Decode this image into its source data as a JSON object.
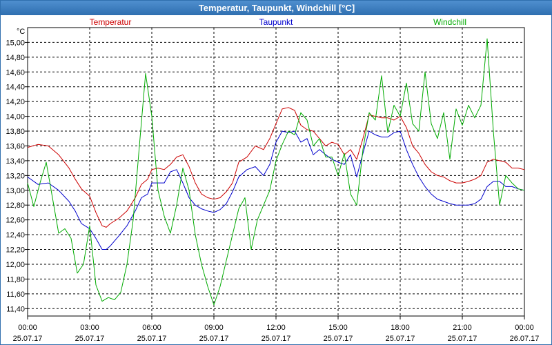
{
  "window": {
    "title": "Temperatur, Taupunkt, Windchill [°C]"
  },
  "chart_data": {
    "type": "line",
    "title": "Temperatur, Taupunkt, Windchill [°C]",
    "ylabel": "°C",
    "ylim": [
      11.3,
      15.2
    ],
    "xlim": [
      0,
      24
    ],
    "grid": true,
    "legend_position": "top",
    "x_ticks": [
      {
        "x": 0,
        "time": "00:00",
        "date": "25.07.17"
      },
      {
        "x": 3,
        "time": "03:00",
        "date": "25.07.17"
      },
      {
        "x": 6,
        "time": "06:00",
        "date": "25.07.17"
      },
      {
        "x": 9,
        "time": "09:00",
        "date": "25.07.17"
      },
      {
        "x": 12,
        "time": "12:00",
        "date": "25.07.17"
      },
      {
        "x": 15,
        "time": "15:00",
        "date": "25.07.17"
      },
      {
        "x": 18,
        "time": "18:00",
        "date": "25.07.17"
      },
      {
        "x": 21,
        "time": "21:00",
        "date": "25.07.17"
      },
      {
        "x": 24,
        "time": "00:00",
        "date": "26.07.17"
      }
    ],
    "y_ticks": [
      "11,40",
      "11,60",
      "11,80",
      "12,00",
      "12,20",
      "12,40",
      "12,60",
      "12,80",
      "13,00",
      "13,20",
      "13,40",
      "13,60",
      "13,80",
      "14,00",
      "14,20",
      "14,40",
      "14,60",
      "14,80",
      "15,00"
    ],
    "y_tick_values": [
      11.4,
      11.6,
      11.8,
      12.0,
      12.2,
      12.4,
      12.6,
      12.8,
      13.0,
      13.2,
      13.4,
      13.6,
      13.8,
      14.0,
      14.2,
      14.4,
      14.6,
      14.8,
      15.0
    ],
    "series": [
      {
        "name": "Temperatur",
        "color": "#cc0000",
        "x": [
          0,
          0.5,
          1.0,
          1.5,
          2.0,
          2.3,
          2.6,
          3.0,
          3.3,
          3.6,
          3.8,
          4.0,
          4.4,
          4.8,
          5.2,
          5.5,
          5.8,
          6.0,
          6.3,
          6.6,
          6.9,
          7.2,
          7.5,
          7.8,
          8.1,
          8.4,
          8.7,
          9.0,
          9.3,
          9.6,
          9.9,
          10.2,
          10.6,
          11.0,
          11.4,
          11.7,
          12.0,
          12.3,
          12.6,
          12.9,
          13.2,
          13.5,
          13.8,
          14.1,
          14.4,
          14.7,
          15.0,
          15.3,
          15.6,
          15.9,
          16.2,
          16.5,
          16.8,
          17.1,
          17.4,
          17.7,
          18.0,
          18.3,
          18.6,
          18.9,
          19.2,
          19.5,
          19.8,
          20.1,
          20.4,
          20.7,
          21.0,
          21.3,
          21.6,
          21.9,
          22.2,
          22.5,
          22.8,
          23.1,
          23.4,
          23.7,
          24.0
        ],
        "y": [
          13.58,
          13.62,
          13.6,
          13.48,
          13.3,
          13.15,
          13.02,
          12.92,
          12.7,
          12.52,
          12.5,
          12.55,
          12.62,
          12.72,
          12.9,
          13.08,
          13.15,
          13.28,
          13.3,
          13.28,
          13.35,
          13.45,
          13.48,
          13.32,
          13.1,
          12.95,
          12.9,
          12.88,
          12.9,
          12.98,
          13.1,
          13.38,
          13.45,
          13.6,
          13.55,
          13.7,
          13.9,
          14.1,
          14.12,
          14.08,
          13.88,
          13.82,
          13.8,
          13.7,
          13.6,
          13.65,
          13.62,
          13.48,
          13.55,
          13.42,
          13.7,
          14.02,
          14.0,
          13.98,
          13.98,
          13.95,
          14.0,
          13.85,
          13.6,
          13.5,
          13.35,
          13.25,
          13.2,
          13.18,
          13.13,
          13.1,
          13.1,
          13.12,
          13.15,
          13.2,
          13.38,
          13.42,
          13.4,
          13.38,
          13.3,
          13.3,
          13.28
        ]
      },
      {
        "name": "Taupunkt",
        "color": "#0000cc",
        "x": [
          0,
          0.5,
          1.0,
          1.5,
          2.0,
          2.3,
          2.6,
          3.0,
          3.3,
          3.6,
          3.8,
          4.0,
          4.4,
          4.8,
          5.2,
          5.5,
          5.8,
          6.0,
          6.3,
          6.6,
          6.9,
          7.2,
          7.5,
          7.8,
          8.1,
          8.4,
          8.7,
          9.0,
          9.3,
          9.6,
          9.9,
          10.2,
          10.6,
          11.0,
          11.4,
          11.7,
          12.0,
          12.3,
          12.6,
          12.9,
          13.2,
          13.5,
          13.8,
          14.1,
          14.4,
          14.7,
          15.0,
          15.3,
          15.6,
          15.9,
          16.2,
          16.5,
          16.8,
          17.1,
          17.4,
          17.7,
          18.0,
          18.3,
          18.6,
          18.9,
          19.2,
          19.5,
          19.8,
          20.1,
          20.4,
          20.7,
          21.0,
          21.3,
          21.6,
          21.9,
          22.2,
          22.5,
          22.8,
          23.1,
          23.4,
          23.7,
          24.0
        ],
        "y": [
          13.18,
          13.08,
          13.1,
          13.0,
          12.85,
          12.72,
          12.55,
          12.48,
          12.35,
          12.2,
          12.2,
          12.25,
          12.38,
          12.52,
          12.72,
          12.9,
          12.95,
          13.1,
          13.1,
          13.1,
          13.25,
          13.28,
          13.1,
          12.9,
          12.8,
          12.75,
          12.72,
          12.7,
          12.74,
          12.82,
          12.98,
          13.18,
          13.28,
          13.32,
          13.2,
          13.35,
          13.65,
          13.8,
          13.78,
          13.8,
          13.65,
          13.7,
          13.48,
          13.55,
          13.48,
          13.42,
          13.38,
          13.35,
          13.48,
          13.18,
          13.5,
          13.8,
          13.75,
          13.72,
          13.72,
          13.78,
          13.8,
          13.55,
          13.35,
          13.18,
          13.05,
          12.95,
          12.88,
          12.85,
          12.82,
          12.8,
          12.8,
          12.8,
          12.82,
          12.88,
          13.05,
          13.12,
          13.12,
          13.05,
          13.05,
          13.02,
          13.0
        ]
      },
      {
        "name": "Windchill",
        "color": "#00aa00",
        "x": [
          0,
          0.3,
          0.6,
          0.9,
          1.2,
          1.5,
          1.8,
          2.1,
          2.4,
          2.7,
          3.0,
          3.3,
          3.6,
          3.9,
          4.2,
          4.5,
          4.8,
          5.1,
          5.4,
          5.7,
          6.0,
          6.3,
          6.6,
          6.9,
          7.2,
          7.5,
          7.8,
          8.1,
          8.4,
          8.7,
          9.0,
          9.3,
          9.6,
          9.9,
          10.2,
          10.5,
          10.8,
          11.1,
          11.4,
          11.7,
          12.0,
          12.3,
          12.6,
          12.9,
          13.2,
          13.5,
          13.8,
          14.1,
          14.4,
          14.7,
          15.0,
          15.3,
          15.6,
          15.9,
          16.2,
          16.5,
          16.8,
          17.1,
          17.4,
          17.7,
          18.0,
          18.3,
          18.6,
          18.9,
          19.2,
          19.5,
          19.8,
          20.1,
          20.4,
          20.7,
          21.0,
          21.3,
          21.6,
          21.9,
          22.2,
          22.5,
          22.8,
          23.1,
          23.4,
          23.7,
          24.0
        ],
        "y": [
          13.1,
          12.78,
          13.1,
          13.38,
          12.9,
          12.42,
          12.48,
          12.35,
          11.88,
          12.0,
          12.52,
          11.72,
          11.5,
          11.55,
          11.52,
          11.62,
          12.0,
          12.6,
          13.6,
          14.58,
          14.0,
          13.0,
          12.65,
          12.42,
          12.8,
          13.3,
          13.0,
          12.4,
          12.0,
          11.7,
          11.45,
          11.7,
          12.05,
          12.4,
          12.75,
          12.9,
          12.2,
          12.6,
          12.8,
          13.0,
          13.4,
          13.62,
          13.8,
          13.75,
          14.05,
          13.95,
          13.6,
          13.7,
          13.45,
          13.45,
          13.2,
          13.5,
          12.95,
          12.8,
          13.55,
          14.05,
          13.95,
          14.55,
          13.78,
          14.15,
          14.0,
          14.45,
          13.9,
          13.8,
          14.6,
          13.9,
          13.7,
          14.05,
          13.42,
          14.1,
          13.88,
          14.15,
          13.98,
          14.15,
          15.05,
          13.8,
          12.8,
          13.2,
          13.1,
          13.02,
          13.0
        ]
      }
    ]
  }
}
